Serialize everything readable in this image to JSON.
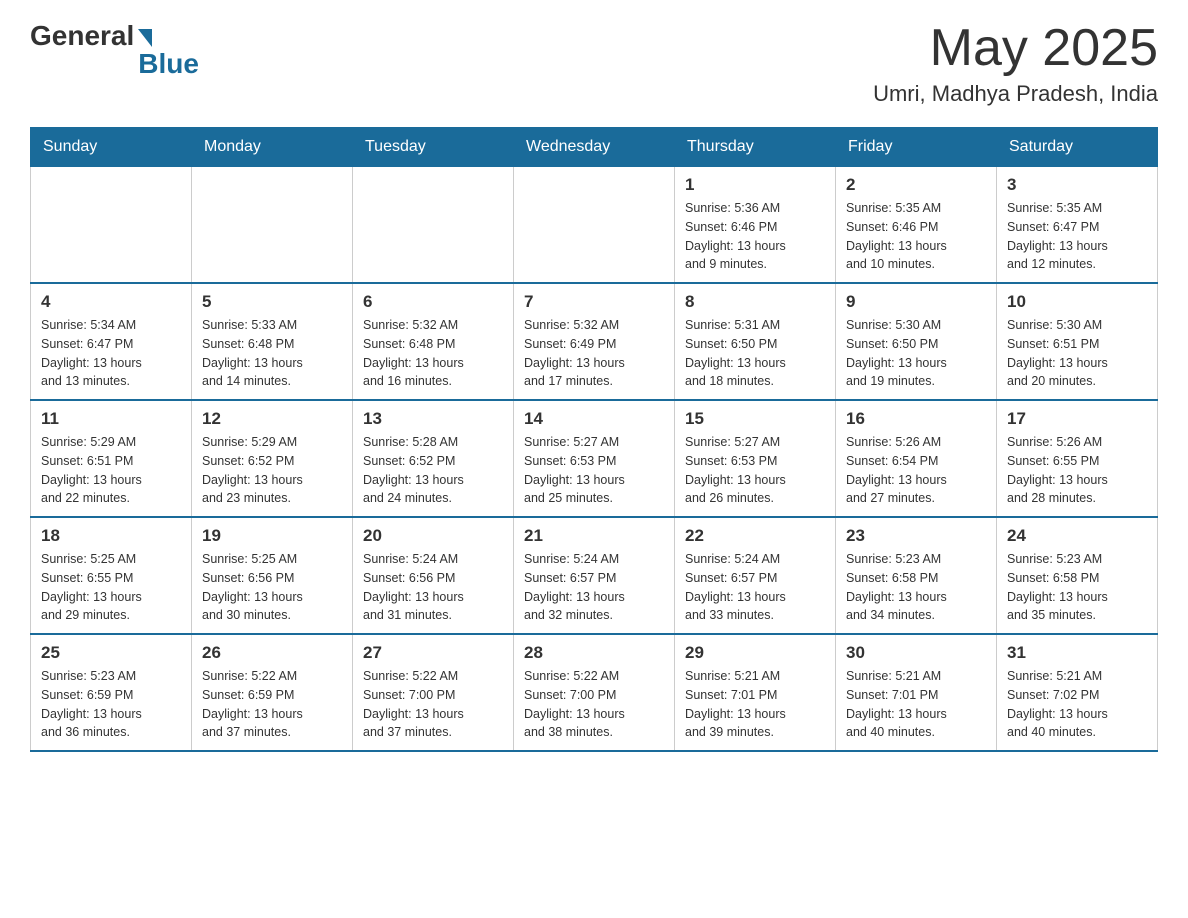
{
  "header": {
    "logo_general": "General",
    "logo_blue": "Blue",
    "month_title": "May 2025",
    "location": "Umri, Madhya Pradesh, India"
  },
  "weekdays": [
    "Sunday",
    "Monday",
    "Tuesday",
    "Wednesday",
    "Thursday",
    "Friday",
    "Saturday"
  ],
  "weeks": [
    [
      {
        "day": "",
        "info": ""
      },
      {
        "day": "",
        "info": ""
      },
      {
        "day": "",
        "info": ""
      },
      {
        "day": "",
        "info": ""
      },
      {
        "day": "1",
        "info": "Sunrise: 5:36 AM\nSunset: 6:46 PM\nDaylight: 13 hours\nand 9 minutes."
      },
      {
        "day": "2",
        "info": "Sunrise: 5:35 AM\nSunset: 6:46 PM\nDaylight: 13 hours\nand 10 minutes."
      },
      {
        "day": "3",
        "info": "Sunrise: 5:35 AM\nSunset: 6:47 PM\nDaylight: 13 hours\nand 12 minutes."
      }
    ],
    [
      {
        "day": "4",
        "info": "Sunrise: 5:34 AM\nSunset: 6:47 PM\nDaylight: 13 hours\nand 13 minutes."
      },
      {
        "day": "5",
        "info": "Sunrise: 5:33 AM\nSunset: 6:48 PM\nDaylight: 13 hours\nand 14 minutes."
      },
      {
        "day": "6",
        "info": "Sunrise: 5:32 AM\nSunset: 6:48 PM\nDaylight: 13 hours\nand 16 minutes."
      },
      {
        "day": "7",
        "info": "Sunrise: 5:32 AM\nSunset: 6:49 PM\nDaylight: 13 hours\nand 17 minutes."
      },
      {
        "day": "8",
        "info": "Sunrise: 5:31 AM\nSunset: 6:50 PM\nDaylight: 13 hours\nand 18 minutes."
      },
      {
        "day": "9",
        "info": "Sunrise: 5:30 AM\nSunset: 6:50 PM\nDaylight: 13 hours\nand 19 minutes."
      },
      {
        "day": "10",
        "info": "Sunrise: 5:30 AM\nSunset: 6:51 PM\nDaylight: 13 hours\nand 20 minutes."
      }
    ],
    [
      {
        "day": "11",
        "info": "Sunrise: 5:29 AM\nSunset: 6:51 PM\nDaylight: 13 hours\nand 22 minutes."
      },
      {
        "day": "12",
        "info": "Sunrise: 5:29 AM\nSunset: 6:52 PM\nDaylight: 13 hours\nand 23 minutes."
      },
      {
        "day": "13",
        "info": "Sunrise: 5:28 AM\nSunset: 6:52 PM\nDaylight: 13 hours\nand 24 minutes."
      },
      {
        "day": "14",
        "info": "Sunrise: 5:27 AM\nSunset: 6:53 PM\nDaylight: 13 hours\nand 25 minutes."
      },
      {
        "day": "15",
        "info": "Sunrise: 5:27 AM\nSunset: 6:53 PM\nDaylight: 13 hours\nand 26 minutes."
      },
      {
        "day": "16",
        "info": "Sunrise: 5:26 AM\nSunset: 6:54 PM\nDaylight: 13 hours\nand 27 minutes."
      },
      {
        "day": "17",
        "info": "Sunrise: 5:26 AM\nSunset: 6:55 PM\nDaylight: 13 hours\nand 28 minutes."
      }
    ],
    [
      {
        "day": "18",
        "info": "Sunrise: 5:25 AM\nSunset: 6:55 PM\nDaylight: 13 hours\nand 29 minutes."
      },
      {
        "day": "19",
        "info": "Sunrise: 5:25 AM\nSunset: 6:56 PM\nDaylight: 13 hours\nand 30 minutes."
      },
      {
        "day": "20",
        "info": "Sunrise: 5:24 AM\nSunset: 6:56 PM\nDaylight: 13 hours\nand 31 minutes."
      },
      {
        "day": "21",
        "info": "Sunrise: 5:24 AM\nSunset: 6:57 PM\nDaylight: 13 hours\nand 32 minutes."
      },
      {
        "day": "22",
        "info": "Sunrise: 5:24 AM\nSunset: 6:57 PM\nDaylight: 13 hours\nand 33 minutes."
      },
      {
        "day": "23",
        "info": "Sunrise: 5:23 AM\nSunset: 6:58 PM\nDaylight: 13 hours\nand 34 minutes."
      },
      {
        "day": "24",
        "info": "Sunrise: 5:23 AM\nSunset: 6:58 PM\nDaylight: 13 hours\nand 35 minutes."
      }
    ],
    [
      {
        "day": "25",
        "info": "Sunrise: 5:23 AM\nSunset: 6:59 PM\nDaylight: 13 hours\nand 36 minutes."
      },
      {
        "day": "26",
        "info": "Sunrise: 5:22 AM\nSunset: 6:59 PM\nDaylight: 13 hours\nand 37 minutes."
      },
      {
        "day": "27",
        "info": "Sunrise: 5:22 AM\nSunset: 7:00 PM\nDaylight: 13 hours\nand 37 minutes."
      },
      {
        "day": "28",
        "info": "Sunrise: 5:22 AM\nSunset: 7:00 PM\nDaylight: 13 hours\nand 38 minutes."
      },
      {
        "day": "29",
        "info": "Sunrise: 5:21 AM\nSunset: 7:01 PM\nDaylight: 13 hours\nand 39 minutes."
      },
      {
        "day": "30",
        "info": "Sunrise: 5:21 AM\nSunset: 7:01 PM\nDaylight: 13 hours\nand 40 minutes."
      },
      {
        "day": "31",
        "info": "Sunrise: 5:21 AM\nSunset: 7:02 PM\nDaylight: 13 hours\nand 40 minutes."
      }
    ]
  ]
}
